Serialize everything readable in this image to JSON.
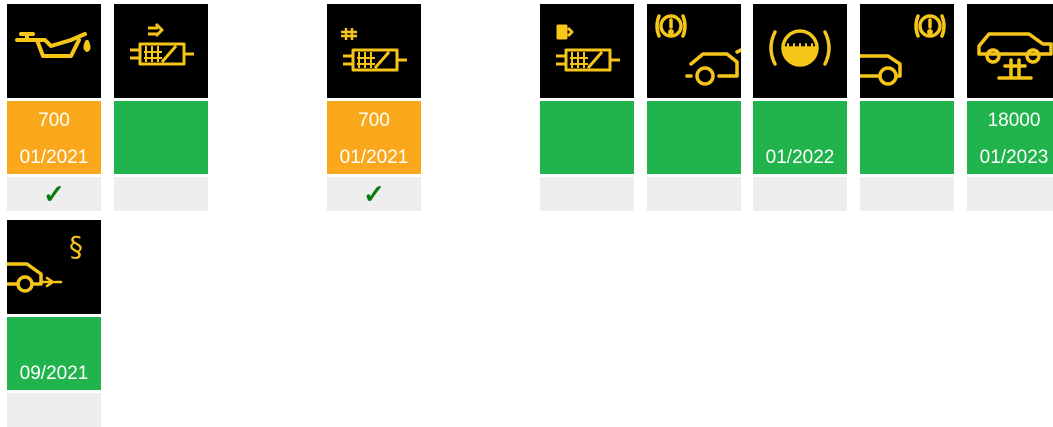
{
  "colors": {
    "icon_bg": "#000000",
    "icon_yellow": "#f5c518",
    "warning": "#f9a81c",
    "ok": "#21b44c",
    "check_bg": "#eeeeee",
    "check_mark": "#0a7a12"
  },
  "tiles": [
    {
      "icon": "oil-can-icon",
      "status": "warning",
      "line1": "700",
      "line2": "01/2021",
      "check": "✓"
    },
    {
      "icon": "fuel-filter-icon",
      "status": "ok",
      "line1": "",
      "line2": "",
      "check": ""
    },
    {
      "icon": "air-filter-icon",
      "status": "warning",
      "line1": "700",
      "line2": "01/2021",
      "check": "✓"
    },
    {
      "icon": "fuel-pump-filter-icon",
      "status": "ok",
      "line1": "",
      "line2": "",
      "check": ""
    },
    {
      "icon": "brake-front-car-icon",
      "status": "ok",
      "line1": "",
      "line2": "",
      "check": ""
    },
    {
      "icon": "brake-fluid-icon",
      "status": "ok",
      "line1": "",
      "line2": "01/2022",
      "check": ""
    },
    {
      "icon": "brake-rear-car-icon",
      "status": "ok",
      "line1": "",
      "line2": "",
      "check": ""
    },
    {
      "icon": "car-lift-inspection-icon",
      "status": "ok",
      "line1": "18000",
      "line2": "01/2023",
      "check": ""
    },
    {
      "icon": "emissions-inspection-icon",
      "status": "ok",
      "line1": "",
      "line2": "09/2021",
      "check": ""
    }
  ]
}
